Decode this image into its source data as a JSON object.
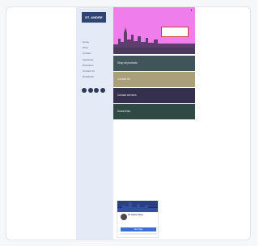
{
  "site": {
    "logo_text": "ST. ANDRE",
    "nav": [
      "Home",
      "Shop",
      "Contact",
      "Facebook",
      "Directions",
      "Contact Us",
      "Newsletter"
    ],
    "social_icons": [
      "facebook-icon",
      "twitter-icon",
      "youtube-icon",
      "instagram-icon"
    ]
  },
  "hero": {
    "topline": "",
    "badge_line1": "",
    "badge_line2": "",
    "corner_icon": "f"
  },
  "bands": [
    "Shop all products",
    "Contact Us",
    "Contact services",
    "Social links"
  ],
  "article": {
    "title": "",
    "paragraphs": []
  },
  "facebook": {
    "page_name": "St. Andre Shop",
    "likes": "",
    "status": "",
    "button": "Like Page"
  },
  "colors": {
    "hero_bg": "#f07dec",
    "band_1": "#3f5559",
    "band_2": "#a9a07a",
    "band_3": "#34304d",
    "band_4": "#2f4a44",
    "sidebar_bg": "#e4eaf6",
    "link_blue": "#3b69c9",
    "fb_button": "#3b6fd8"
  }
}
